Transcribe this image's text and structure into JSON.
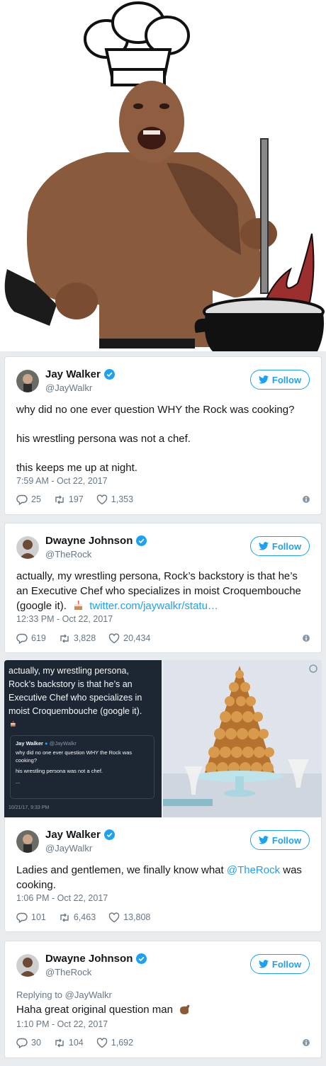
{
  "colors": {
    "twitter_blue": "#1da1f2",
    "muted": "#657786",
    "dark_card": "#1c2733",
    "flame": "#9b2e2e"
  },
  "tweets": [
    {
      "name": "Jay Walker",
      "handle": "@JayWalkr",
      "follow_label": "Follow",
      "lines": [
        "why did no one ever question WHY the Rock was cooking?",
        "his wrestling persona was not a chef.",
        "this keeps me up at night."
      ],
      "time": "7:59 AM - Oct 22, 2017",
      "replies": "25",
      "retweets": "197",
      "likes": "1,353"
    },
    {
      "name": "Dwayne Johnson",
      "handle": "@TheRock",
      "follow_label": "Follow",
      "text": "actually, my wrestling persona, Rock’s backstory is that he’s an Executive Chef who specializes in moist Croquembouche (google it).",
      "link": "twitter.com/jaywalkr/statu…",
      "time": "12:33 PM - Oct 22, 2017",
      "replies": "619",
      "retweets": "3,828",
      "likes": "20,434"
    },
    {
      "name": "Jay Walker",
      "handle": "@JayWalkr",
      "follow_label": "Follow",
      "text_before": "Ladies and gentlemen, we finally know what ",
      "mention": "@TheRock",
      "text_after": " was cooking.",
      "time": "1:06 PM - Oct 22, 2017",
      "replies": "101",
      "retweets": "6,463",
      "likes": "13,808"
    },
    {
      "name": "Dwayne Johnson",
      "handle": "@TheRock",
      "follow_label": "Follow",
      "reply_to": "Replying to @JayWalkr",
      "text": "Haha great original question man",
      "time": "1:10 PM - Oct 22, 2017",
      "replies": "30",
      "retweets": "104",
      "likes": "1,692"
    }
  ],
  "screenshot": {
    "text": "actually, my wrestling persona, Rock’s backstory is that he’s an Executive Chef who specializes in moist Croquembouche (google it).",
    "quote_name": "Jay Walker",
    "quote_handle": "@JayWalkr",
    "quote_line1": "why did no one ever question WHY the Rock was cooking?",
    "quote_line2": "his wrestling persona was not a chef.",
    "quote_more": "...",
    "stamp": "10/21/17, 9:33 PM"
  }
}
